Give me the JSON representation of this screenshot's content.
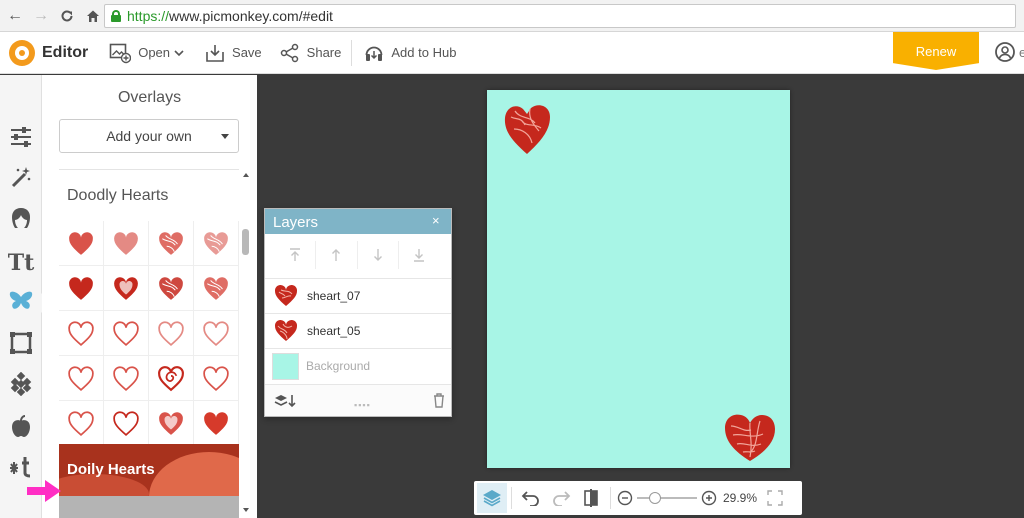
{
  "browser": {
    "url_scheme": "https://",
    "url_rest": "www.picmonkey.com/#edit"
  },
  "toolbar": {
    "app_name": "Editor",
    "open_label": "Open",
    "save_label": "Save",
    "share_label": "Share",
    "hub_label": "Add to Hub",
    "renew_label": "Renew",
    "more_text": "e"
  },
  "rail": {
    "icons": [
      "adjust-sliders-icon",
      "magic-wand-icon",
      "touchup-face-icon",
      "text-icon",
      "overlays-butterfly-icon",
      "frames-icon",
      "textures-icon",
      "seasonal-apple-icon",
      "themes-icon"
    ],
    "active_index": 4
  },
  "panel": {
    "title": "Overlays",
    "add_own_label": "Add your own",
    "group_title": "Doodly Hearts",
    "next_group_label": "Doily Hearts"
  },
  "layers": {
    "title": "Layers",
    "close_symbol": "×",
    "arrange_buttons": [
      "bring-to-front",
      "bring-forward",
      "send-backward",
      "send-to-back"
    ],
    "items": [
      {
        "name": "sheart_07"
      },
      {
        "name": "sheart_05"
      },
      {
        "name": "Background"
      }
    ]
  },
  "canvas": {
    "background_color": "#a8f5e6",
    "heart_color": "#c5281d"
  },
  "zoom": {
    "value_label": "29.9%",
    "slider_fraction": 0.3
  },
  "colors": {
    "accent_orange": "#f39a1c",
    "renew_yellow": "#f9b000",
    "layers_header": "#7fb4c7",
    "pink_arrow": "#ff2ec4"
  }
}
